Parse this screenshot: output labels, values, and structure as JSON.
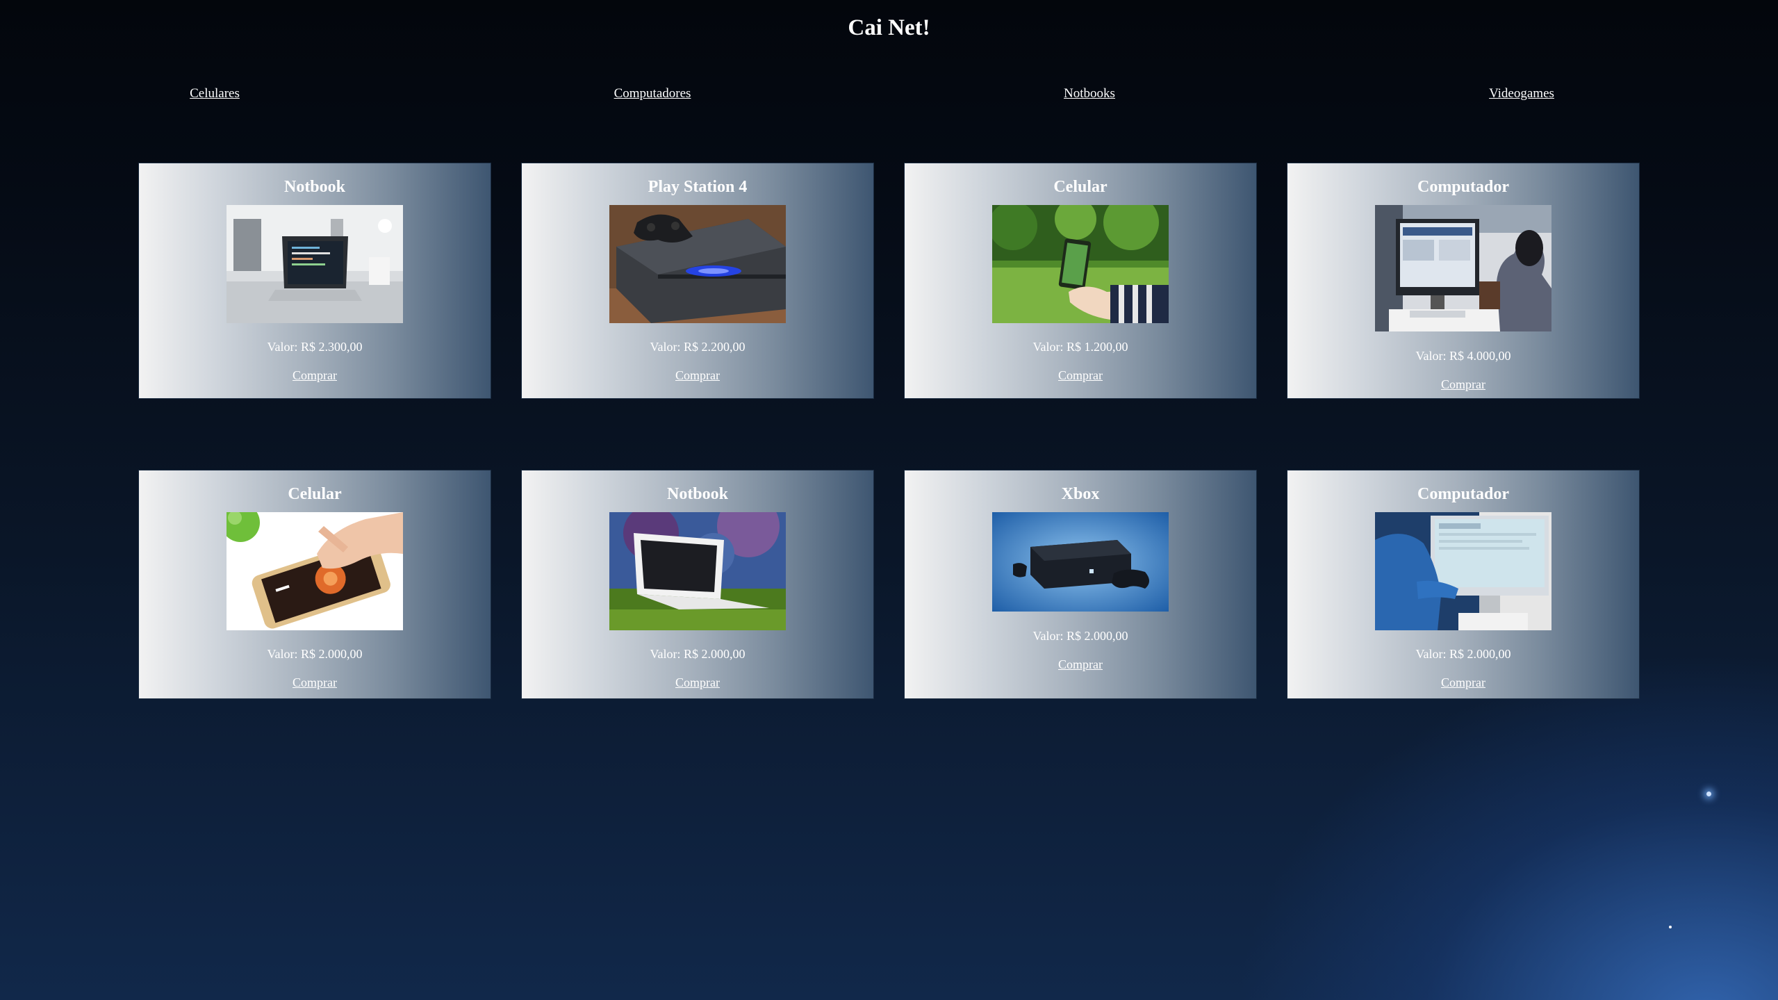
{
  "header": {
    "title": "Cai Net!"
  },
  "nav": {
    "items": [
      {
        "label": "Celulares"
      },
      {
        "label": "Computadores"
      },
      {
        "label": "Notbooks"
      },
      {
        "label": "Videogames"
      }
    ]
  },
  "products": [
    {
      "title": "Notbook",
      "price": "Valor: R$ 2.300,00",
      "buy": "Comprar",
      "image": "laptop-desk-photo"
    },
    {
      "title": "Play Station 4",
      "price": "Valor: R$ 2.200,00",
      "buy": "Comprar",
      "image": "playstation-4-photo"
    },
    {
      "title": "Celular",
      "price": "Valor: R$ 1.200,00",
      "buy": "Comprar",
      "image": "phone-in-park-photo"
    },
    {
      "title": "Computador",
      "price": "Valor: R$ 4.000,00",
      "buy": "Comprar",
      "image": "office-computer-photo"
    },
    {
      "title": "Celular",
      "price": "Valor: R$ 2.000,00",
      "buy": "Comprar",
      "image": "smartphone-touch-photo"
    },
    {
      "title": "Notbook",
      "price": "Valor: R$ 2.000,00",
      "buy": "Comprar",
      "image": "white-laptop-grass-photo"
    },
    {
      "title": "Xbox",
      "price": "Valor: R$ 2.000,00",
      "buy": "Comprar",
      "image": "xbox-one-photo"
    },
    {
      "title": "Computador",
      "price": "Valor: R$ 2.000,00",
      "buy": "Comprar",
      "image": "imac-user-photo"
    }
  ]
}
